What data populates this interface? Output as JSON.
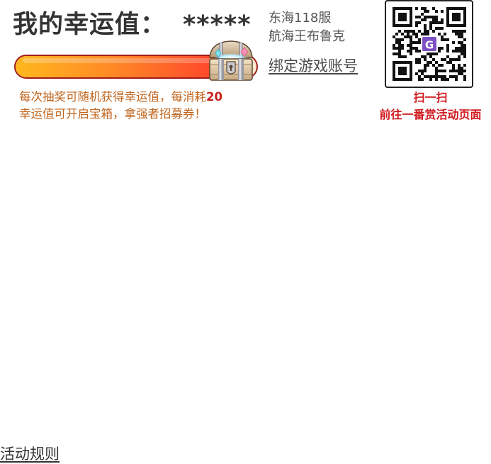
{
  "luck": {
    "title": "我的幸运值：",
    "value": "*****",
    "progress_percent": 88
  },
  "description": {
    "part1": "每次抽奖可随机获得幸运值，每消耗",
    "number": "20",
    "part2": "幸运值可开启宝箱，拿强者招募券！"
  },
  "account": {
    "server": "东海118服",
    "character": "航海王布鲁克",
    "bind_label": "绑定游戏账号"
  },
  "qr": {
    "center_logo": "G",
    "caption_line1": "扫一扫",
    "caption_line2": "前往一番赏活动页面"
  },
  "footer": {
    "rules_label": "活动规则"
  },
  "colors": {
    "accent_red": "#d0191e",
    "desc_orange": "#c0641c",
    "bar_border": "#a11c1c"
  },
  "icons": {
    "chest": "treasure-chest-icon",
    "qr": "qr-code-icon"
  }
}
